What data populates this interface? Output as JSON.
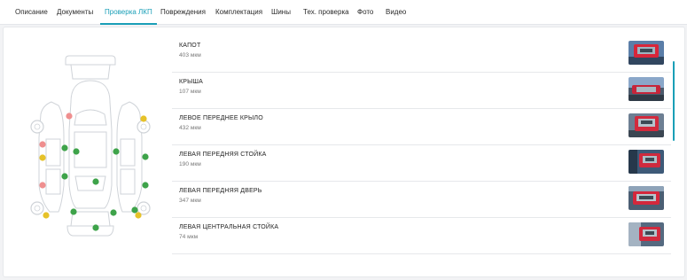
{
  "tabs": [
    {
      "label": "Описание",
      "active": false
    },
    {
      "label": "Документы",
      "active": false
    },
    {
      "label": "Проверка ЛКП",
      "active": true
    },
    {
      "label": "Повреждения",
      "active": false
    },
    {
      "label": "Комплектация",
      "active": false
    },
    {
      "label": "Шины",
      "active": false
    },
    {
      "label": "Тех. проверка",
      "active": false
    },
    {
      "label": "Фото",
      "active": false
    },
    {
      "label": "Видео",
      "active": false
    }
  ],
  "colors": {
    "accent": "#1a9fb7",
    "status_green": "#3ea34a",
    "status_yellow": "#e6c229",
    "status_red": "#ef8f8f"
  },
  "diagram": {
    "markers": [
      {
        "status": "red"
      },
      {
        "status": "yellow"
      },
      {
        "status": "red"
      },
      {
        "status": "yellow"
      },
      {
        "status": "green"
      },
      {
        "status": "green"
      },
      {
        "status": "green"
      },
      {
        "status": "red"
      },
      {
        "status": "green"
      },
      {
        "status": "green"
      },
      {
        "status": "green"
      },
      {
        "status": "green"
      },
      {
        "status": "green"
      },
      {
        "status": "yellow"
      },
      {
        "status": "green"
      },
      {
        "status": "green"
      },
      {
        "status": "yellow"
      },
      {
        "status": "green"
      }
    ]
  },
  "measurements": [
    {
      "name": "КАПОТ",
      "value": "403 мкм"
    },
    {
      "name": "КРЫША",
      "value": "107 мкм"
    },
    {
      "name": "ЛЕВОЕ ПЕРЕДНЕЕ КРЫЛО",
      "value": "432 мкм"
    },
    {
      "name": "ЛЕВАЯ ПЕРЕДНЯЯ СТОЙКА",
      "value": "190 мкм"
    },
    {
      "name": "ЛЕВАЯ ПЕРЕДНЯЯ ДВЕРЬ",
      "value": "347 мкм"
    },
    {
      "name": "ЛЕВАЯ ЦЕНТРАЛЬНАЯ СТОЙКА",
      "value": "74 мкм"
    }
  ]
}
